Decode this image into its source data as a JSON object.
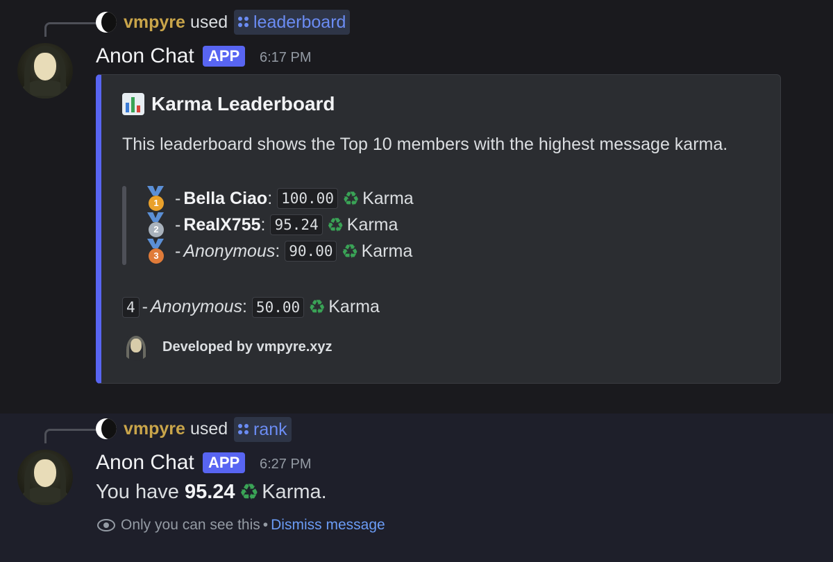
{
  "colors": {
    "accent": "#5865f2",
    "username": "#c9a54a",
    "command": "#6b8cf3",
    "link": "#6b9cf5",
    "karma_icon": "#3aa356"
  },
  "message1": {
    "reply": {
      "user": "vmpyre",
      "used": "used",
      "command": "leaderboard"
    },
    "author": "Anon Chat",
    "badge": "APP",
    "time": "6:17 PM",
    "embed": {
      "title_icon": "bar-chart-icon",
      "title": "Karma Leaderboard",
      "description": "This leaderboard shows the Top 10 members with the highest message karma.",
      "entries": [
        {
          "rank_icon": "gold-medal-icon",
          "name": "Bella Ciao",
          "value": "100.00",
          "unit": "Karma"
        },
        {
          "rank_icon": "silver-medal-icon",
          "name": "RealX755",
          "value": "95.24",
          "unit": "Karma"
        },
        {
          "rank_icon": "bronze-medal-icon",
          "name": "Anonymous",
          "value": "90.00",
          "unit": "Karma"
        },
        {
          "rank": "4",
          "name": "Anonymous",
          "value": "50.00",
          "unit": "Karma"
        }
      ],
      "footer": "Developed by vmpyre.xyz"
    }
  },
  "message2": {
    "reply": {
      "user": "vmpyre",
      "used": "used",
      "command": "rank"
    },
    "author": "Anon Chat",
    "badge": "APP",
    "time": "6:27 PM",
    "text_prefix": "You have",
    "value": "95.24",
    "text_suffix": "Karma.",
    "ephemeral_note": "Only you can see this",
    "bullet": "•",
    "dismiss": "Dismiss message"
  }
}
